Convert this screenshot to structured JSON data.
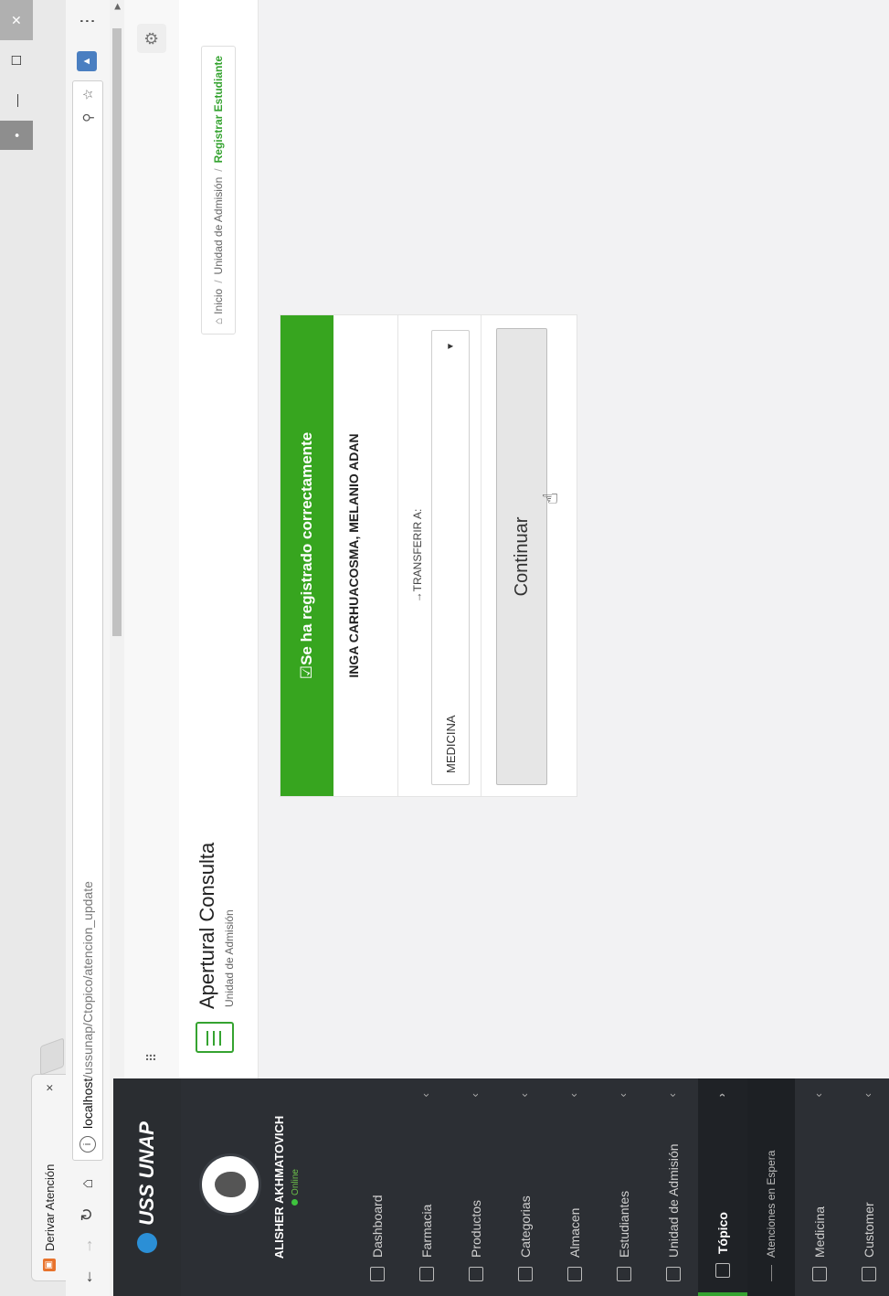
{
  "browser": {
    "tab_title": "Derivar Atención",
    "tab_close": "×",
    "url_host": "localhost",
    "url_path": "/ussunap/Ctopico/atencion_update"
  },
  "app": {
    "logo_text": "USS UNAP"
  },
  "user": {
    "name": "ALISHER AKHMATOVICH",
    "status": "Online"
  },
  "sidebar": {
    "items": [
      {
        "label": "Dashboard",
        "chevron": ""
      },
      {
        "label": "Farmacia",
        "chevron": "‹"
      },
      {
        "label": "Productos",
        "chevron": "‹"
      },
      {
        "label": "Categorias",
        "chevron": "‹"
      },
      {
        "label": "Almacen",
        "chevron": "‹"
      },
      {
        "label": "Estudiantes",
        "chevron": "‹"
      },
      {
        "label": "Unidad de Admisión",
        "chevron": "‹"
      },
      {
        "label": "Tópico",
        "chevron": "›"
      }
    ],
    "subitem": "Atenciones en Espera",
    "items_after": [
      {
        "label": "Medicina",
        "chevron": "‹"
      },
      {
        "label": "Customer",
        "chevron": "‹"
      }
    ]
  },
  "page": {
    "title": "Apertural Consulta",
    "subtitle": "Unidad de Admisión",
    "breadcrumb": [
      "Inicio",
      "Unidad de Admisión",
      "Registrar Estudiante"
    ]
  },
  "card": {
    "header": "☑Se ha registrado correctamente",
    "student_name": "INGA CARHUACOSMA, MELANIO ADAN",
    "transfer_label": "→TRANSFERIR A:",
    "select_value": "MEDICINA",
    "continue_label": "Continuar"
  }
}
